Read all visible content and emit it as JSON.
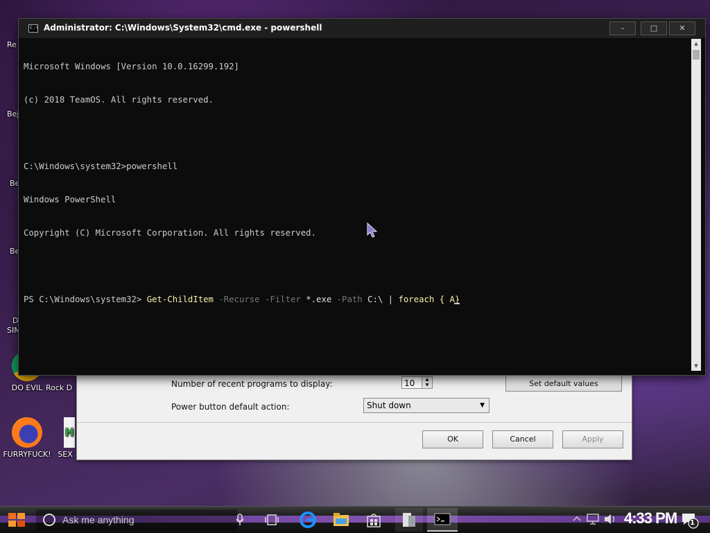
{
  "desktop": {
    "icons": [
      {
        "label": "DO EVIL",
        "color": "#2e9e3a"
      },
      {
        "label": "Rock D",
        "color": "#444444"
      },
      {
        "label": "FURRYFUCK!",
        "color": "#ff7a1a"
      },
      {
        "label": "SEX",
        "color": "#2e9e3a"
      }
    ],
    "side_labels": [
      "Re",
      "Bej",
      "Be",
      "Be",
      "D",
      "SIM"
    ]
  },
  "settings_dialog": {
    "recent_programs_label": "Number of recent programs to display:",
    "recent_programs_value": "10",
    "set_default_label": "Set default values",
    "power_label": "Power button default action:",
    "power_value": "Shut down",
    "ok_label": "OK",
    "cancel_label": "Cancel",
    "apply_label": "Apply"
  },
  "cmd_window": {
    "title": "Administrator: C:\\Windows\\System32\\cmd.exe - powershell",
    "icon_text": "C:\\",
    "minimize": "–",
    "maximize": "□",
    "close": "✕",
    "lines": [
      "Microsoft Windows [Version 10.0.16299.192]",
      "(c) 2018 TeamOS. All rights reserved.",
      "",
      "C:\\Windows\\system32>powershell",
      "Windows PowerShell",
      "Copyright (C) Microsoft Corporation. All rights reserved.",
      ""
    ],
    "prompt": {
      "ps": "PS C:\\Windows\\system32> ",
      "cmdlet": "Get-ChildItem",
      "p1": " -Recurse",
      "p2": " -Filter",
      "v2": " *.exe",
      "p3": " -Path",
      "v3": " C:\\ | ",
      "kw": "foreach",
      "rest": " { A}"
    }
  },
  "taskbar": {
    "search_placeholder": "Ask me anything",
    "clock": "4:33 PM",
    "notification_count": "1"
  },
  "colors": {
    "console_bg": "#0c0c0c",
    "console_text": "#cccccc",
    "cmdlet": "#f9f1a5",
    "parameter": "#767676"
  }
}
